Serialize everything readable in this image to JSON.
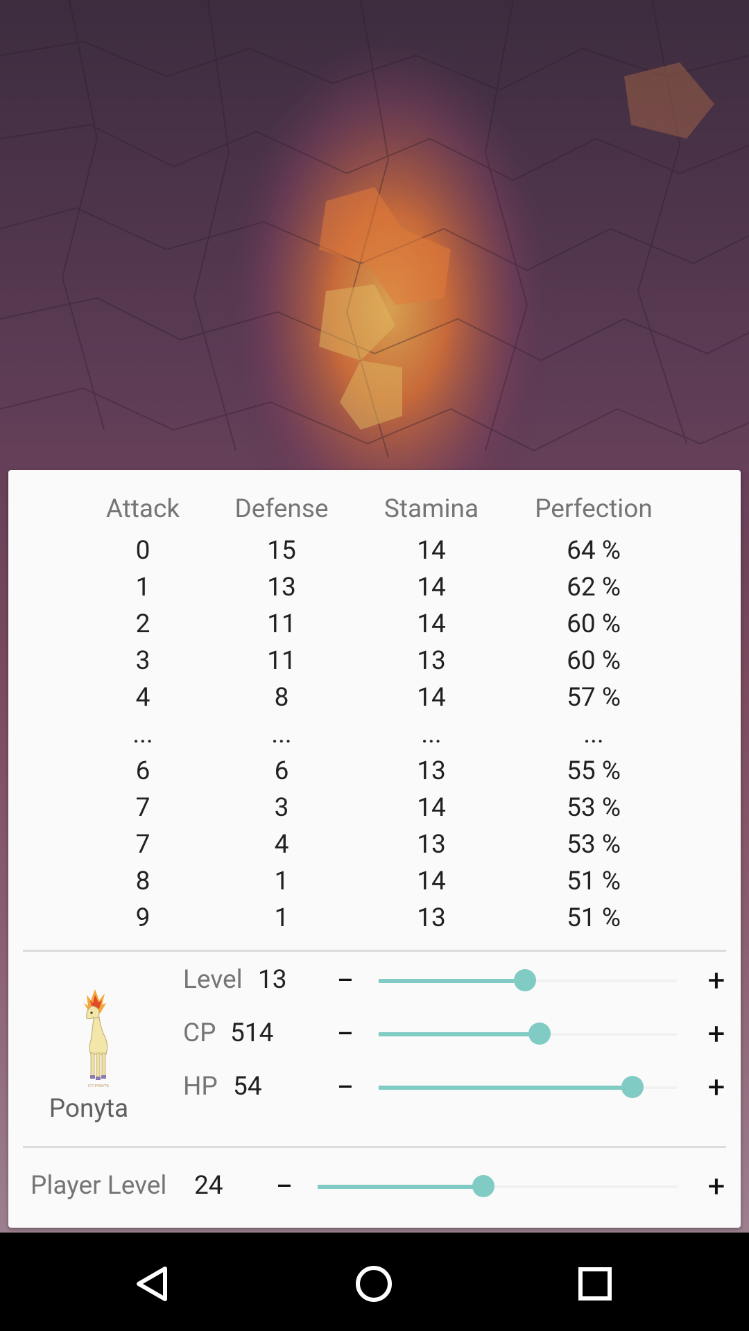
{
  "table": {
    "headers": [
      "Attack",
      "Defense",
      "Stamina",
      "Perfection"
    ],
    "rows": [
      [
        "0",
        "15",
        "14",
        "64 %"
      ],
      [
        "1",
        "13",
        "14",
        "62 %"
      ],
      [
        "2",
        "11",
        "14",
        "60 %"
      ],
      [
        "3",
        "11",
        "13",
        "60 %"
      ],
      [
        "4",
        "8",
        "14",
        "57 %"
      ],
      [
        "...",
        "...",
        "...",
        "..."
      ],
      [
        "6",
        "6",
        "13",
        "55 %"
      ],
      [
        "7",
        "3",
        "14",
        "53 %"
      ],
      [
        "7",
        "4",
        "13",
        "53 %"
      ],
      [
        "8",
        "1",
        "14",
        "51 %"
      ],
      [
        "9",
        "1",
        "13",
        "51 %"
      ]
    ]
  },
  "pokemon": {
    "name": "Ponyta",
    "image_caption": "077 PONYTA"
  },
  "stats": {
    "level": {
      "label": "Level",
      "value": "13",
      "minus": "−",
      "plus": "+",
      "slider_fraction": 0.49
    },
    "cp": {
      "label": "CP",
      "value": "514",
      "minus": "−",
      "plus": "+",
      "slider_fraction": 0.54
    },
    "hp": {
      "label": "HP",
      "value": "54",
      "minus": "−",
      "plus": "+",
      "slider_fraction": 0.85
    }
  },
  "player": {
    "label": "Player Level",
    "value": "24",
    "minus": "−",
    "plus": "+",
    "slider_fraction": 0.46
  },
  "colors": {
    "accent": "#80cbc4",
    "card_bg": "#fafafa"
  },
  "navbar": {
    "back_icon": "back-triangle-icon",
    "home_icon": "home-circle-icon",
    "recents_icon": "recents-square-icon"
  }
}
